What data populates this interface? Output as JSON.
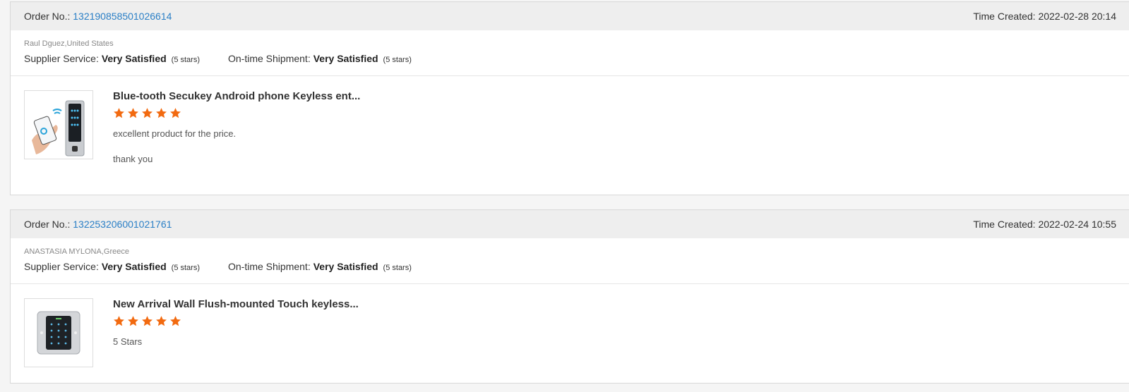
{
  "labels": {
    "order_no": "Order No.:",
    "time_created": "Time Created:",
    "supplier_service": "Supplier Service:",
    "ontime_shipment": "On-time Shipment:"
  },
  "colors": {
    "star": "#f26a10",
    "link": "#2a7fc6"
  },
  "reviews": [
    {
      "order_no": "132190858501026614",
      "time_created": "2022-02-28 20:14",
      "buyer": "Raul Dguez,United States",
      "supplier_value": "Very Satisfied",
      "supplier_stars": "(5 stars)",
      "shipment_value": "Very Satisfied",
      "shipment_stars": "(5 stars)",
      "product_title": "Blue-tooth Secukey Android phone Keyless ent...",
      "rating": 5,
      "comment_1": "excellent product for the price.",
      "comment_2": "thank you"
    },
    {
      "order_no": "132253206001021761",
      "time_created": "2022-02-24 10:55",
      "buyer": "ANASTASIA MYLONA,Greece",
      "supplier_value": "Very Satisfied",
      "supplier_stars": "(5 stars)",
      "shipment_value": "Very Satisfied",
      "shipment_stars": "(5 stars)",
      "product_title": "New Arrival Wall Flush-mounted Touch keyless...",
      "rating": 5,
      "comment_1": "5 Stars"
    }
  ]
}
